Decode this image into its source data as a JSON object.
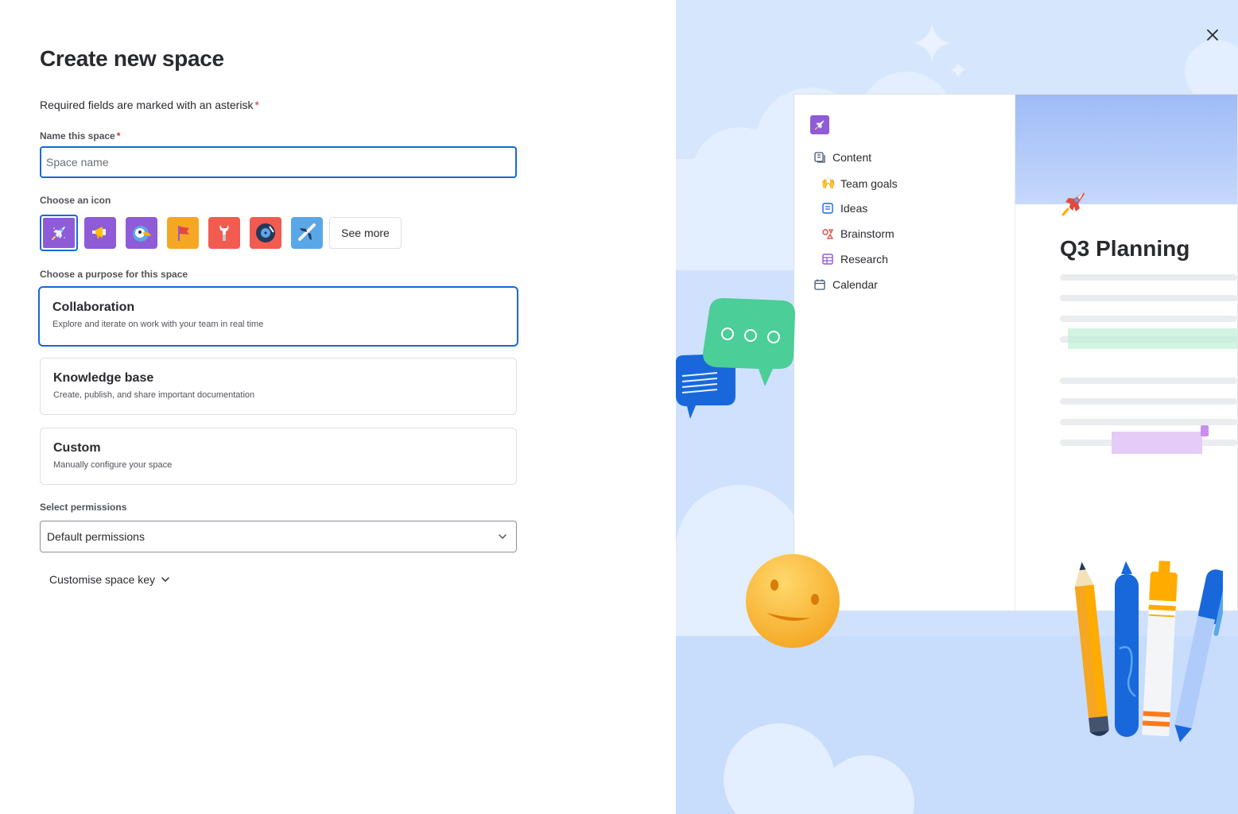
{
  "form": {
    "title": "Create new space",
    "required_note": "Required fields are marked with an asterisk",
    "asterisk": "*",
    "name_label": "Name this space",
    "name_placeholder": "Space name",
    "name_value": "",
    "icon_label": "Choose an icon",
    "icons": [
      {
        "name": "rocket",
        "color": "#8f5bd6",
        "selected": true
      },
      {
        "name": "megaphone",
        "color": "#8f5bd6"
      },
      {
        "name": "toucan",
        "color": "#8f5bd6"
      },
      {
        "name": "flag",
        "color": "#f5a623"
      },
      {
        "name": "wrench",
        "color": "#f15b50"
      },
      {
        "name": "vinyl-record",
        "color": "#f15b50"
      },
      {
        "name": "airplane",
        "color": "#5aa7e8"
      }
    ],
    "see_more_label": "See more",
    "purpose_label": "Choose a purpose for this space",
    "purposes": [
      {
        "title": "Collaboration",
        "description": "Explore and iterate on work with your team in real time",
        "selected": true
      },
      {
        "title": "Knowledge base",
        "description": "Create, publish, and share important documentation",
        "selected": false
      },
      {
        "title": "Custom",
        "description": "Manually configure your space",
        "selected": false
      }
    ],
    "permissions_label": "Select permissions",
    "permissions_value": "Default permissions",
    "space_key_toggle": "Customise space key"
  },
  "preview": {
    "nav": [
      {
        "label": "Content",
        "icon": "pages-icon"
      },
      {
        "label": "Team goals",
        "icon": "raised-hands-emoji"
      },
      {
        "label": "Ideas",
        "icon": "document-icon"
      },
      {
        "label": "Brainstorm",
        "icon": "shapes-icon"
      },
      {
        "label": "Research",
        "icon": "table-icon"
      },
      {
        "label": "Calendar",
        "icon": "calendar-icon"
      }
    ],
    "page_title": "Q3 Planning",
    "emoji_team_goals": "🙌"
  },
  "colors": {
    "accent": "#1868db",
    "required": "#c9372c",
    "panel_bg": "#cfe1fd"
  }
}
